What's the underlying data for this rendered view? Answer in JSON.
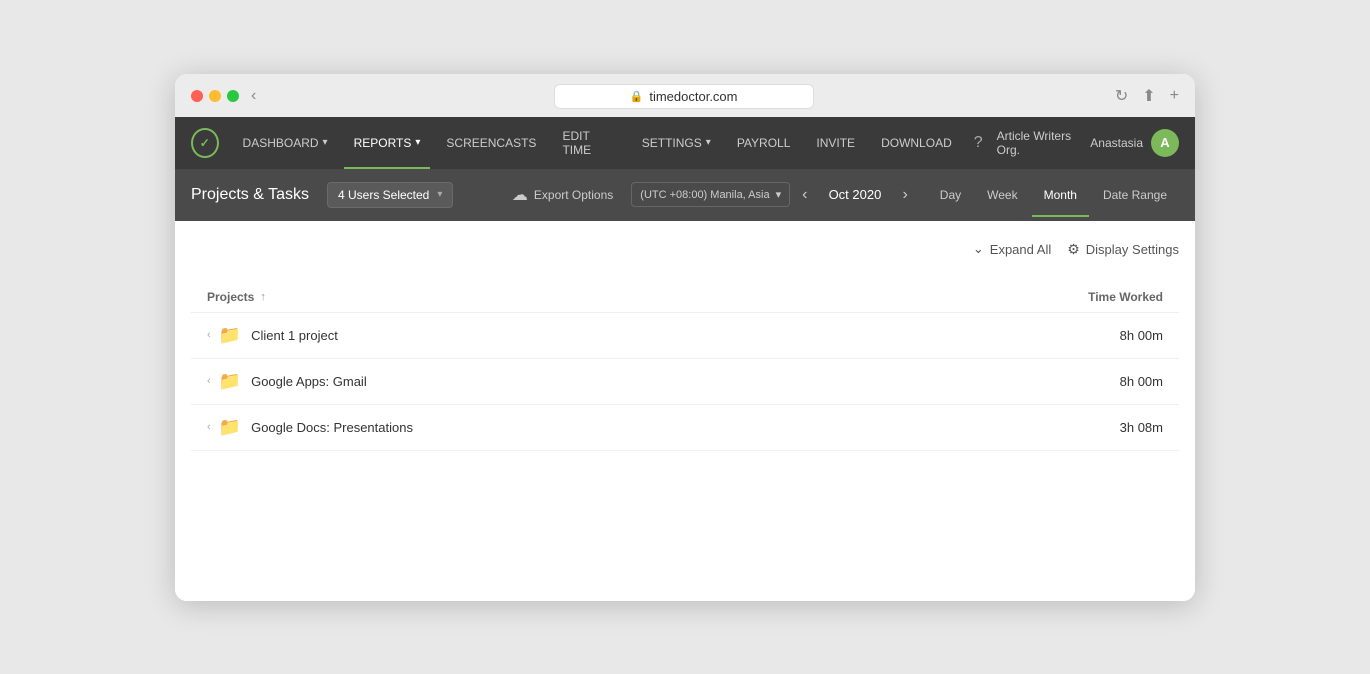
{
  "browser": {
    "url": "timedoctor.com",
    "lock_symbol": "🔒"
  },
  "nav": {
    "logo_text": "✓",
    "items": [
      {
        "label": "DASHBOARD",
        "has_chevron": true,
        "active": false
      },
      {
        "label": "REPORTS",
        "has_chevron": true,
        "active": true
      },
      {
        "label": "SCREENCASTS",
        "has_chevron": false,
        "active": false
      },
      {
        "label": "EDIT TIME",
        "has_chevron": false,
        "active": false
      },
      {
        "label": "SETTINGS",
        "has_chevron": true,
        "active": false
      },
      {
        "label": "PAYROLL",
        "has_chevron": false,
        "active": false
      },
      {
        "label": "INVITE",
        "has_chevron": false,
        "active": false
      },
      {
        "label": "DOWNLOAD",
        "has_chevron": false,
        "active": false
      }
    ],
    "help_symbol": "?",
    "org_name": "Article Writers Org.",
    "user_name": "Anastasia",
    "user_initial": "A"
  },
  "toolbar": {
    "page_title": "Projects & Tasks",
    "users_selected": "4 Users Selected",
    "export_label": "Export Options",
    "timezone": "(UTC +08:00) Manila, Asia",
    "date": "Oct 2020",
    "view_tabs": [
      {
        "label": "Day",
        "active": false
      },
      {
        "label": "Week",
        "active": false
      },
      {
        "label": "Month",
        "active": true
      },
      {
        "label": "Date Range",
        "active": false
      }
    ]
  },
  "content": {
    "expand_all_label": "Expand All",
    "display_settings_label": "Display Settings",
    "table": {
      "col_project": "Projects",
      "col_time": "Time Worked",
      "rows": [
        {
          "name": "Client 1 project",
          "time": "8h 00m"
        },
        {
          "name": "Google Apps: Gmail",
          "time": "8h 00m"
        },
        {
          "name": "Google Docs: Presentations",
          "time": "3h 08m"
        }
      ]
    }
  }
}
